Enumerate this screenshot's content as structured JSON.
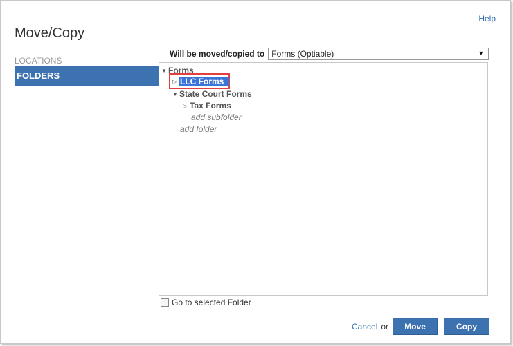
{
  "header": {
    "help_label": "Help",
    "title": "Move/Copy"
  },
  "sidebar": {
    "heading": "LOCATIONS",
    "items": [
      {
        "label": "FOLDERS",
        "selected": true
      }
    ]
  },
  "target": {
    "label": "Will be moved/copied to",
    "selected_value": "Forms (Optiable)"
  },
  "tree": {
    "root_label": "Forms",
    "selected_folder": "LLC Forms",
    "folder_state_court": "State Court Forms",
    "folder_tax": "Tax Forms",
    "add_subfolder": "add subfolder",
    "add_folder": "add folder"
  },
  "options": {
    "goto_label": "Go to selected Folder",
    "goto_checked": false
  },
  "footer": {
    "cancel_label": "Cancel",
    "or_label": "or",
    "move_label": "Move",
    "copy_label": "Copy"
  },
  "colors": {
    "accent": "#3d72b0",
    "selection": "#3c74d8",
    "highlight_box": "#e04040",
    "link": "#2a6db3"
  }
}
